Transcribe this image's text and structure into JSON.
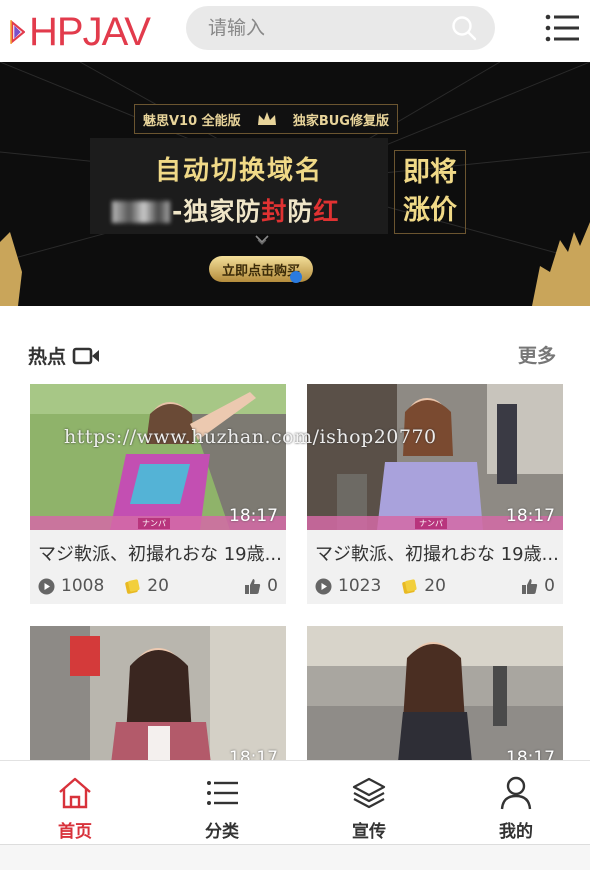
{
  "header": {
    "logo_text": "HPJAV",
    "search_placeholder": "请输入",
    "brand_color": "#e23b4c"
  },
  "banner": {
    "top_left": "魅思V10 全能版",
    "top_right": "独家BUG修复版",
    "line1": "自动切换域名",
    "line2_prefix": "-独家防",
    "line2_red": "封",
    "line2_suffix": "防",
    "line2_red2": "红",
    "side_line1": "即将",
    "side_line2": "涨价",
    "button": "立即点击购买"
  },
  "section": {
    "title": "热点",
    "more": "更多"
  },
  "watermark": "https://www.huzhan.com/ishop20770",
  "videos": [
    {
      "title": "マジ軟派、初撮れおな 19歳...",
      "duration": "18:17",
      "tag": "ナンパ",
      "views": "1008",
      "coins": "20",
      "likes": "0"
    },
    {
      "title": "マジ軟派、初撮れおな 19歳...",
      "duration": "18:17",
      "tag": "ナンパ",
      "views": "1023",
      "coins": "20",
      "likes": "0"
    },
    {
      "title": "",
      "duration": "18:17",
      "tag": "",
      "views": "",
      "coins": "",
      "likes": ""
    },
    {
      "title": "",
      "duration": "18:17",
      "tag": "",
      "views": "",
      "coins": "",
      "likes": ""
    }
  ],
  "tabbar": {
    "items": [
      {
        "label": "首页",
        "icon": "home-icon",
        "active": true
      },
      {
        "label": "分类",
        "icon": "list-icon",
        "active": false
      },
      {
        "label": "宣传",
        "icon": "layers-icon",
        "active": false
      },
      {
        "label": "我的",
        "icon": "user-icon",
        "active": false
      }
    ],
    "active_color": "#d8323b"
  }
}
